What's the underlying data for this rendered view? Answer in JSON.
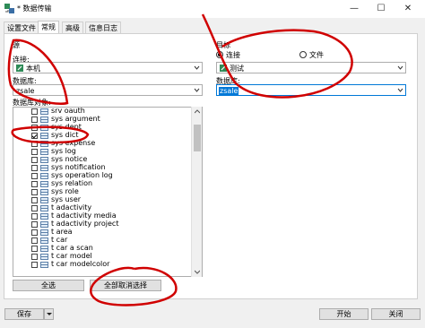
{
  "window": {
    "title": "* 数据传输",
    "controls": [
      "—",
      "☐",
      "✕"
    ]
  },
  "tabs": [
    {
      "label": "设置文件",
      "active": false
    },
    {
      "label": "常规",
      "active": true
    },
    {
      "label": "高级",
      "active": false
    },
    {
      "label": "信息日志",
      "active": false
    }
  ],
  "source": {
    "group_label": "源",
    "connection_label": "连接:",
    "connection_value": "本机",
    "database_label": "数据库:",
    "database_value": "zsale",
    "objects_label": "数据库对象:",
    "objects": [
      {
        "name": "srv oauth",
        "checked": false
      },
      {
        "name": "sys argument",
        "checked": false
      },
      {
        "name": "sys dept",
        "checked": false
      },
      {
        "name": "sys dict",
        "checked": true
      },
      {
        "name": "sys expense",
        "checked": false
      },
      {
        "name": "sys log",
        "checked": false
      },
      {
        "name": "sys notice",
        "checked": false
      },
      {
        "name": "sys notification",
        "checked": false
      },
      {
        "name": "sys operation log",
        "checked": false
      },
      {
        "name": "sys relation",
        "checked": false
      },
      {
        "name": "sys role",
        "checked": false
      },
      {
        "name": "sys user",
        "checked": false
      },
      {
        "name": "t adactivity",
        "checked": false
      },
      {
        "name": "t adactivity media",
        "checked": false
      },
      {
        "name": "t adactivity project",
        "checked": false
      },
      {
        "name": "t area",
        "checked": false
      },
      {
        "name": "t car",
        "checked": false
      },
      {
        "name": "t car a scan",
        "checked": false
      },
      {
        "name": "t car model",
        "checked": false
      },
      {
        "name": "t car modelcolor",
        "checked": false
      }
    ],
    "select_all_label": "全选",
    "deselect_all_label": "全部取消选择"
  },
  "target": {
    "group_label": "目标",
    "radio_connection_label": "连接",
    "radio_file_label": "文件",
    "radio_selected": "连接",
    "connection_value": "测试",
    "database_label": "数据库:",
    "database_value": "zsale"
  },
  "bottom": {
    "save_label": "保存",
    "start_label": "开始",
    "close_label": "关闭"
  },
  "colors": {
    "accent": "#0078d7",
    "annotation": "#d00000"
  }
}
